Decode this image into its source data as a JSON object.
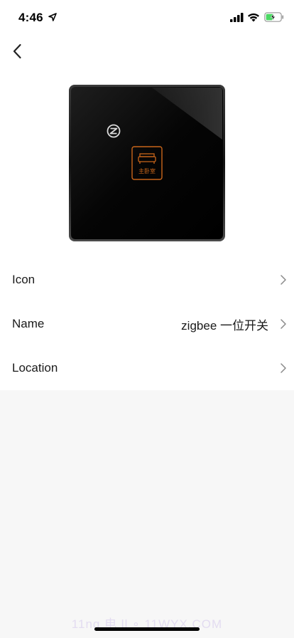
{
  "status_bar": {
    "time": "4:46",
    "icons": [
      "location-arrow-icon",
      "cellular-signal-icon",
      "wifi-icon",
      "battery-charging-icon"
    ],
    "battery_color": "#4cd964"
  },
  "nav": {
    "back_icon": "chevron-left-icon"
  },
  "device": {
    "image": "zigbee-single-gang-switch-image",
    "panel_color": "#0a0a0a",
    "accent_color": "#c8651a",
    "key_label": "主卧室"
  },
  "settings": {
    "rows": [
      {
        "label": "Icon",
        "value": ""
      },
      {
        "label": "Name",
        "value": "zigbee 一位开关"
      },
      {
        "label": "Location",
        "value": ""
      }
    ]
  },
  "watermark": "11ng 电 ll ∘ 11WYX.COM"
}
